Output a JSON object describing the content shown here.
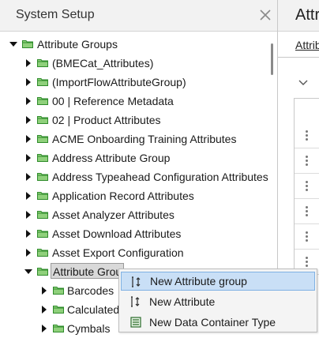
{
  "panel": {
    "title": "System Setup",
    "close_icon": "close-icon"
  },
  "tree": {
    "root_label": "Attribute Groups",
    "items": [
      {
        "label": "(BMECat_Attributes)"
      },
      {
        "label": "(ImportFlowAttributeGroup)"
      },
      {
        "label": "00 | Reference Metadata"
      },
      {
        "label": "02 | Product Attributes"
      },
      {
        "label": "ACME Onboarding Training Attributes"
      },
      {
        "label": "Address Attribute Group"
      },
      {
        "label": "Address Typeahead Configuration Attributes"
      },
      {
        "label": "Application Record Attributes"
      },
      {
        "label": "Asset Analyzer Attributes"
      },
      {
        "label": "Asset Download Attributes"
      },
      {
        "label": "Asset Export Configuration"
      }
    ],
    "selected_label": "Attribute Grou",
    "children": [
      {
        "label": "Barcodes"
      },
      {
        "label": "Calculated"
      },
      {
        "label": "Cymbals"
      }
    ],
    "folder_color": "#3aa335"
  },
  "right_panel": {
    "title": "Attri",
    "tab_label": "Attrib"
  },
  "context_menu": {
    "items": [
      {
        "label": "New Attribute group",
        "icon": "new-attribute-group-icon"
      },
      {
        "label": "New Attribute",
        "icon": "new-attribute-icon"
      },
      {
        "label": "New Data Container Type",
        "icon": "new-data-container-type-icon"
      }
    ],
    "highlight_color": "#c9dff6"
  }
}
